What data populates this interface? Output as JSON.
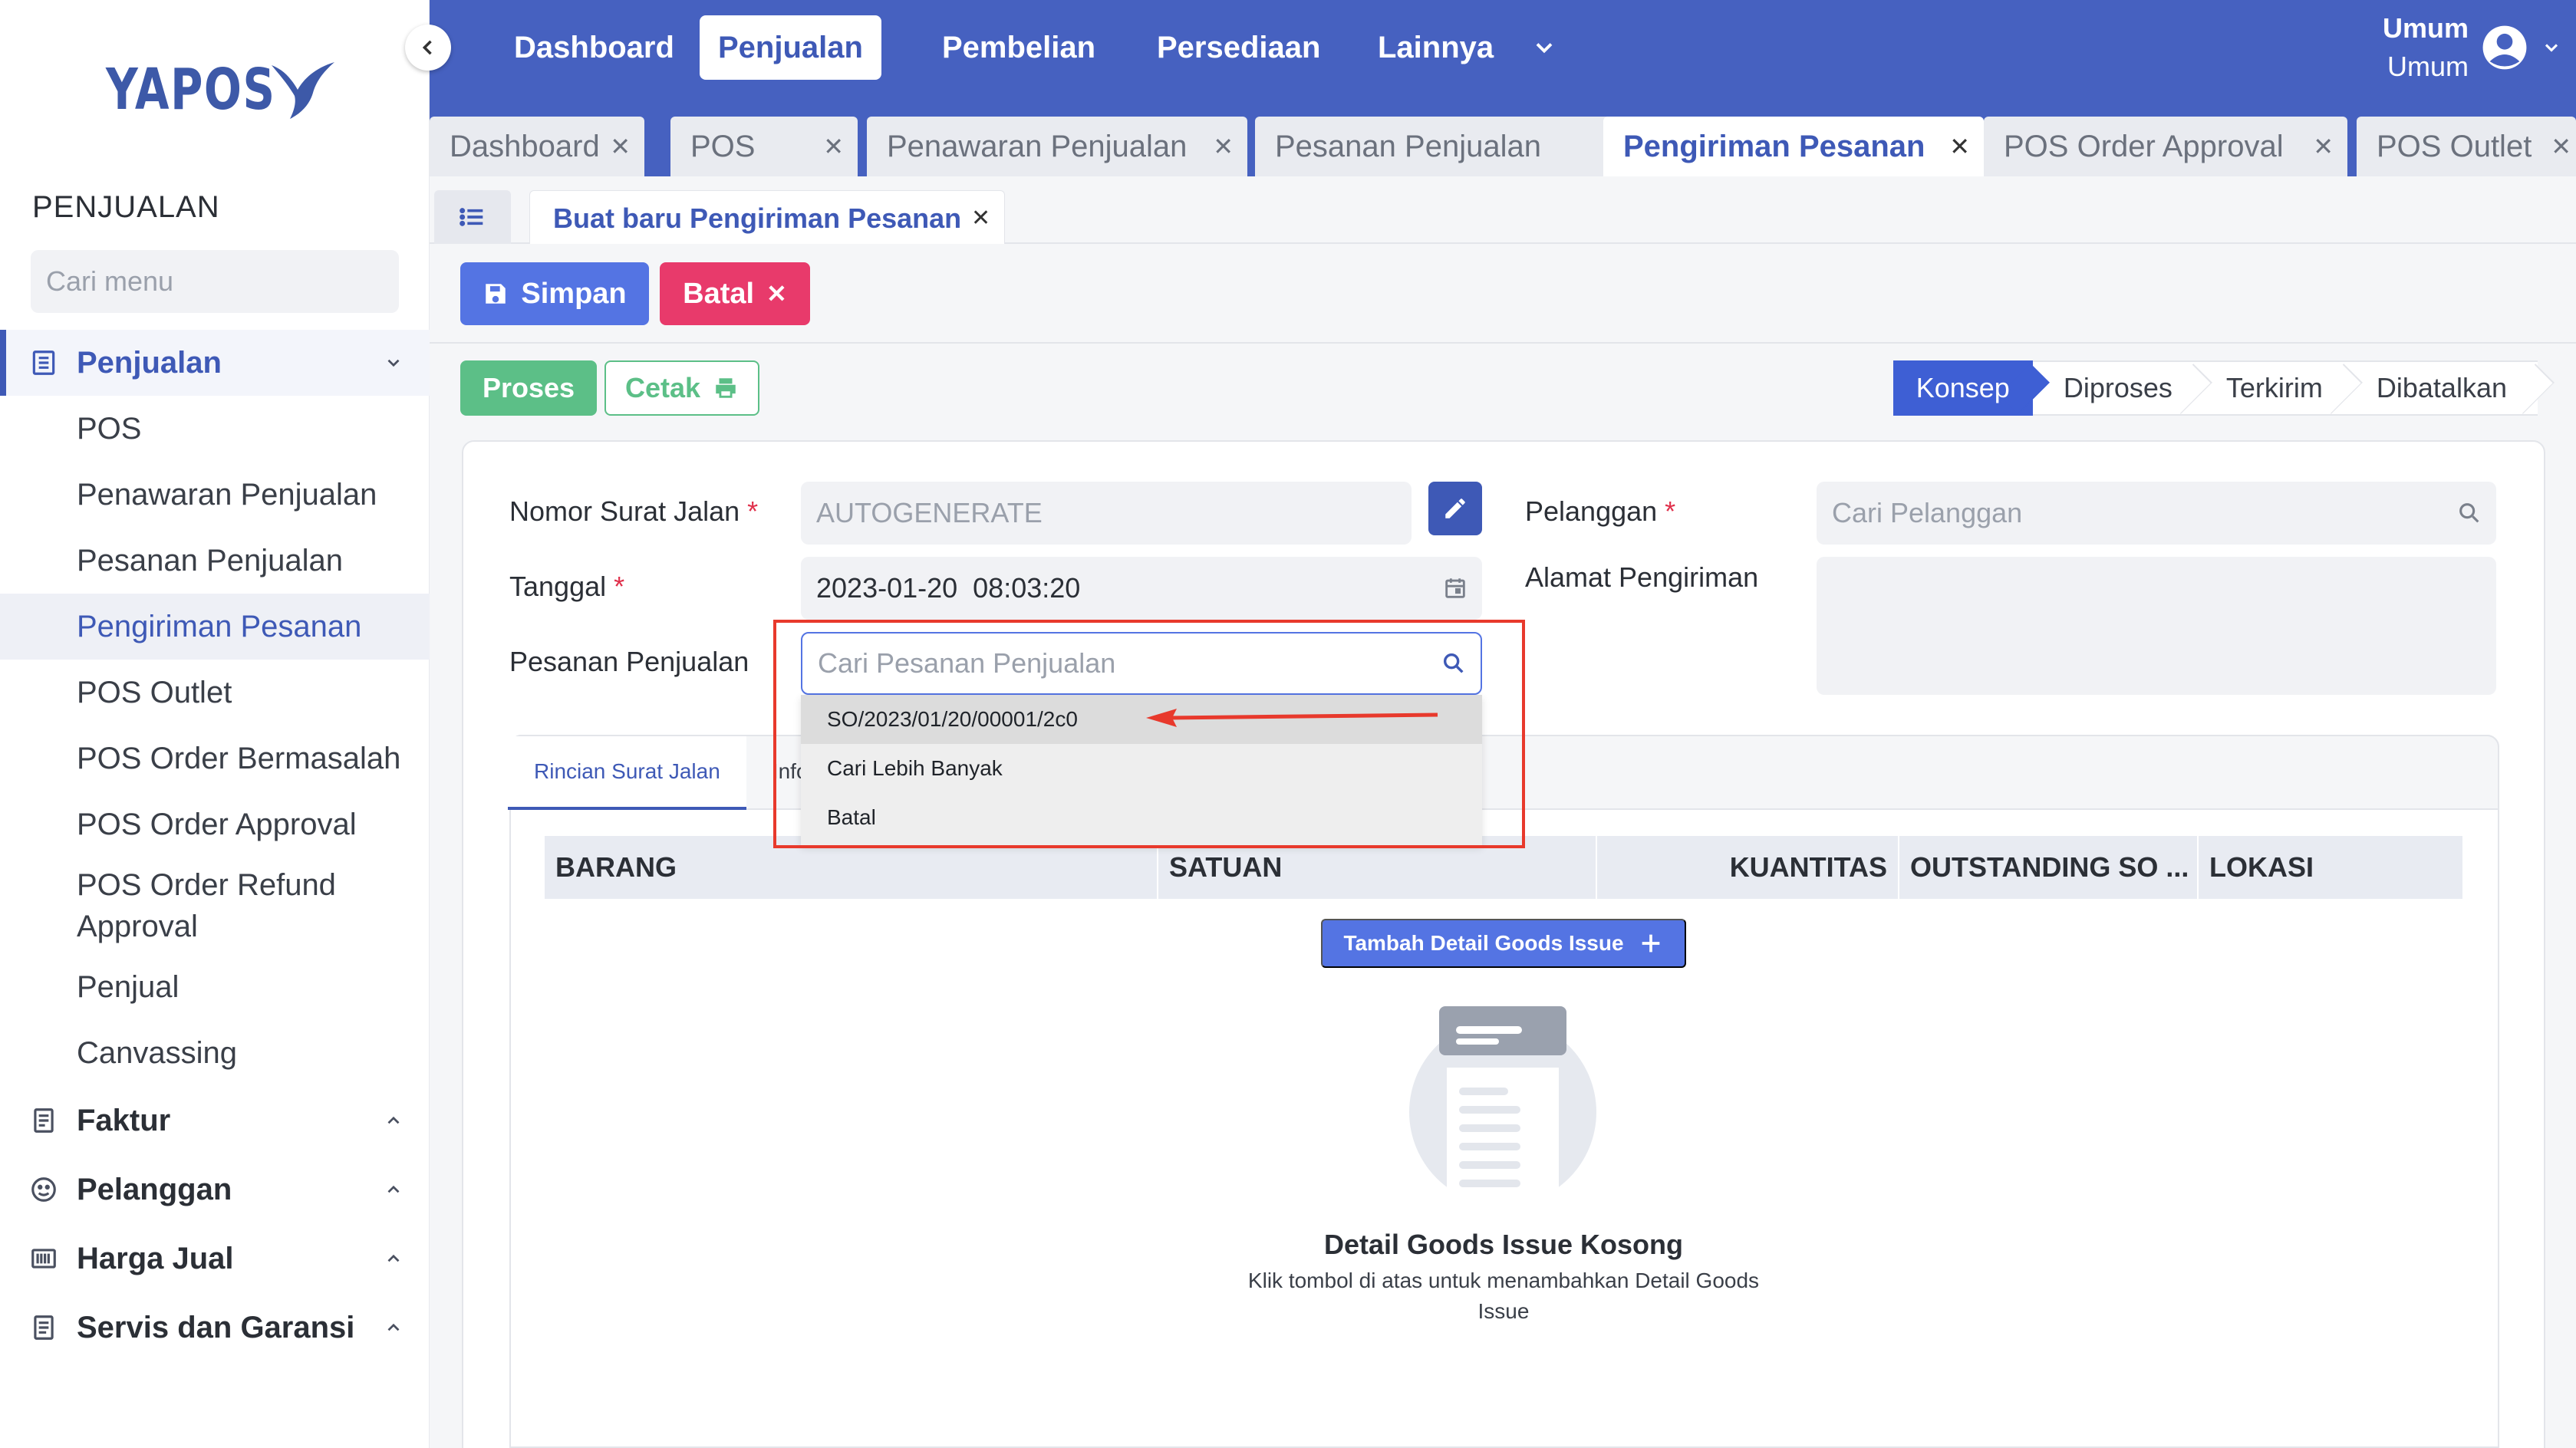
{
  "brand": {
    "name": "YAPOS",
    "color": "#3d59a8"
  },
  "sidebar": {
    "section_title": "PENJUALAN",
    "search_placeholder": "Cari menu",
    "groups": [
      {
        "label": "Penjualan",
        "icon": "list-icon",
        "expanded": true,
        "items": [
          "POS",
          "Penawaran Penjualan",
          "Pesanan Penjualan",
          "Pengiriman Pesanan",
          "POS Outlet",
          "POS Order Bermasalah",
          "POS Order Approval",
          "POS Order Refund Approval",
          "Penjual",
          "Canvassing"
        ],
        "selected": "Pengiriman Pesanan"
      },
      {
        "label": "Faktur",
        "icon": "invoice-icon"
      },
      {
        "label": "Pelanggan",
        "icon": "customer-icon"
      },
      {
        "label": "Harga Jual",
        "icon": "barcode-icon"
      },
      {
        "label": "Servis dan Garansi",
        "icon": "service-icon"
      }
    ]
  },
  "topnav": {
    "items": [
      "Dashboard",
      "Penjualan",
      "Pembelian",
      "Persediaan",
      "Lainnya"
    ],
    "active": "Penjualan",
    "user_name": "Umum",
    "user_role": "Umum"
  },
  "tabs": [
    {
      "label": "Dashboard"
    },
    {
      "label": "POS"
    },
    {
      "label": "Penawaran Penjualan"
    },
    {
      "label": "Pesanan Penjualan"
    },
    {
      "label": "Pengiriman Pesanan",
      "active": true
    },
    {
      "label": "POS Order Approval"
    },
    {
      "label": "POS Outlet"
    }
  ],
  "subtab": {
    "label": "Buat baru Pengiriman Pesanan"
  },
  "toolbar": {
    "save_label": "Simpan",
    "cancel_label": "Batal",
    "process_label": "Proses",
    "print_label": "Cetak"
  },
  "status_steps": [
    "Konsep",
    "Diproses",
    "Terkirim",
    "Dibatalkan"
  ],
  "status_active": "Konsep",
  "form": {
    "nomor_label": "Nomor Surat Jalan",
    "nomor_value": "AUTOGENERATE",
    "tanggal_label": "Tanggal",
    "tanggal_value": "2023-01-20  08:03:20",
    "pesanan_label": "Pesanan Penjualan",
    "pesanan_placeholder": "Cari Pesanan Penjualan",
    "pelanggan_label": "Pelanggan",
    "pelanggan_placeholder": "Cari Pelanggan",
    "alamat_label": "Alamat Pengiriman",
    "required_mark": "*"
  },
  "dropdown": {
    "options": [
      "SO/2023/01/20/00001/2c0",
      "Cari Lebih Banyak",
      "Batal"
    ],
    "highlighted": 0
  },
  "inner_tabs": [
    "Rincian Surat Jalan",
    "Info"
  ],
  "grid": {
    "columns": [
      "BARANG",
      "SATUAN",
      "KUANTITAS",
      "OUTSTANDING SO ...",
      "LOKASI"
    ]
  },
  "add_detail_label": "Tambah Detail Goods Issue",
  "empty_state": {
    "title": "Detail Goods Issue Kosong",
    "description": "Klik tombol di atas untuk menambahkan Detail Goods Issue"
  },
  "colors": {
    "topbar": "#4661c0",
    "primary": "#5474e3",
    "danger": "#e83a6b",
    "success": "#5cbf87",
    "annotation": "#e8392c"
  }
}
